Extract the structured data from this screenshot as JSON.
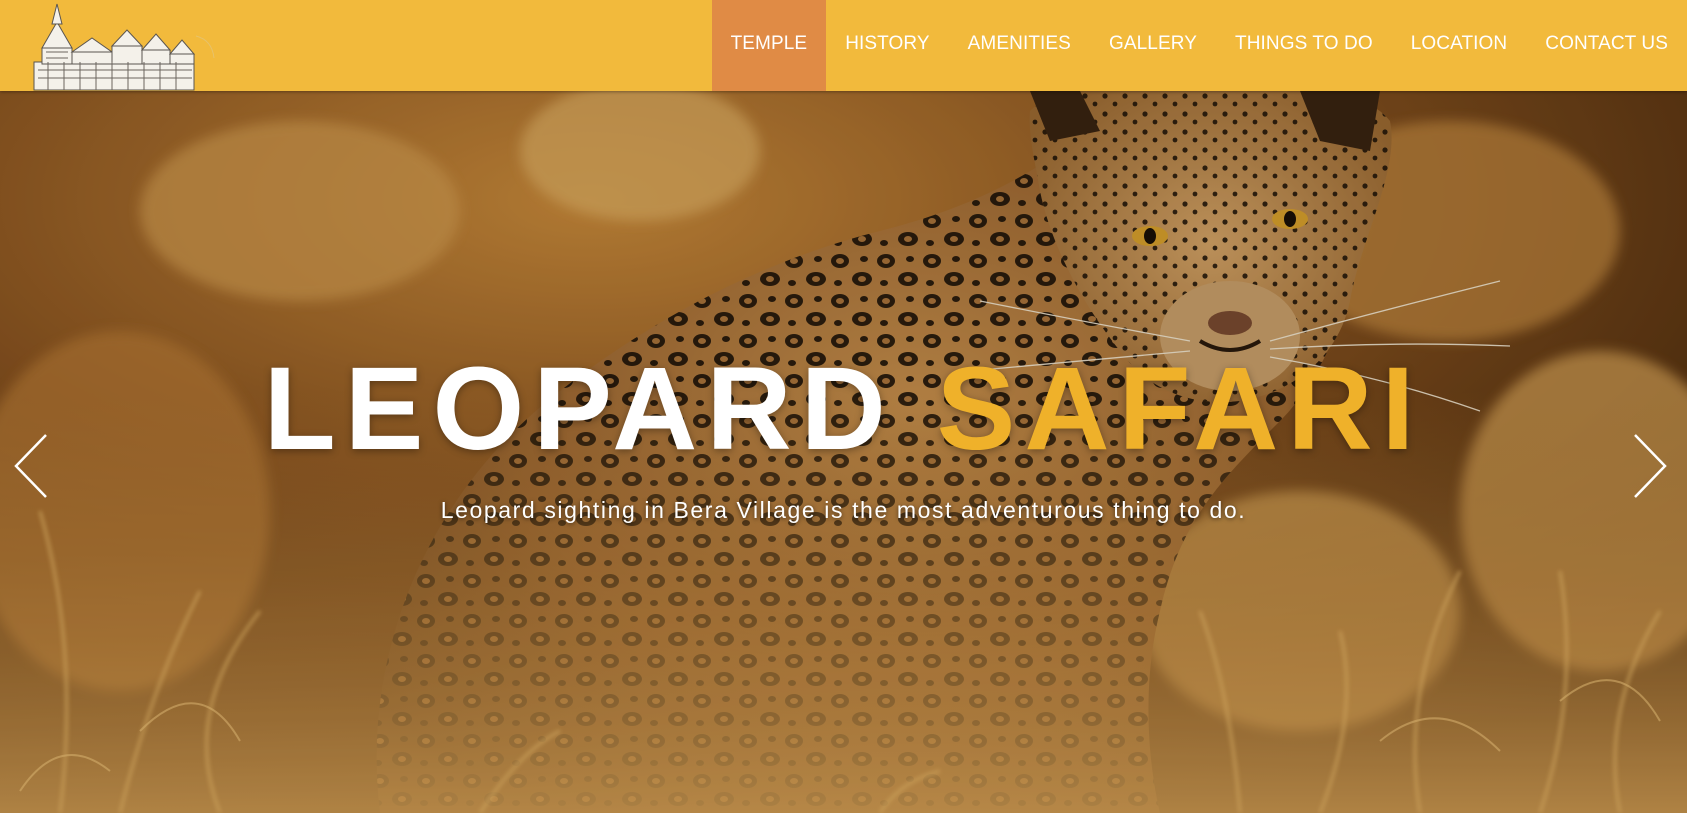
{
  "brand": {
    "logo_icon": "temple-logo-icon"
  },
  "nav": {
    "items": [
      {
        "label": "TEMPLE",
        "active": true
      },
      {
        "label": "HISTORY",
        "active": false
      },
      {
        "label": "AMENITIES",
        "active": false
      },
      {
        "label": "GALLERY",
        "active": false
      },
      {
        "label": "THINGS TO DO",
        "active": false
      },
      {
        "label": "LOCATION",
        "active": false
      },
      {
        "label": "CONTACT US",
        "active": false
      }
    ]
  },
  "hero": {
    "title_word1": "LEOPARD",
    "title_word2": "SAFARI",
    "subtitle": "Leopard sighting in Bera Village is the most adventurous thing to do.",
    "prev_icon": "chevron-left-icon",
    "next_icon": "chevron-right-icon"
  },
  "colors": {
    "navbar_bg": "#f2ba3c",
    "nav_active_bg": "#e08b45",
    "accent_text": "#efb12a",
    "nav_text": "#ffffff"
  }
}
